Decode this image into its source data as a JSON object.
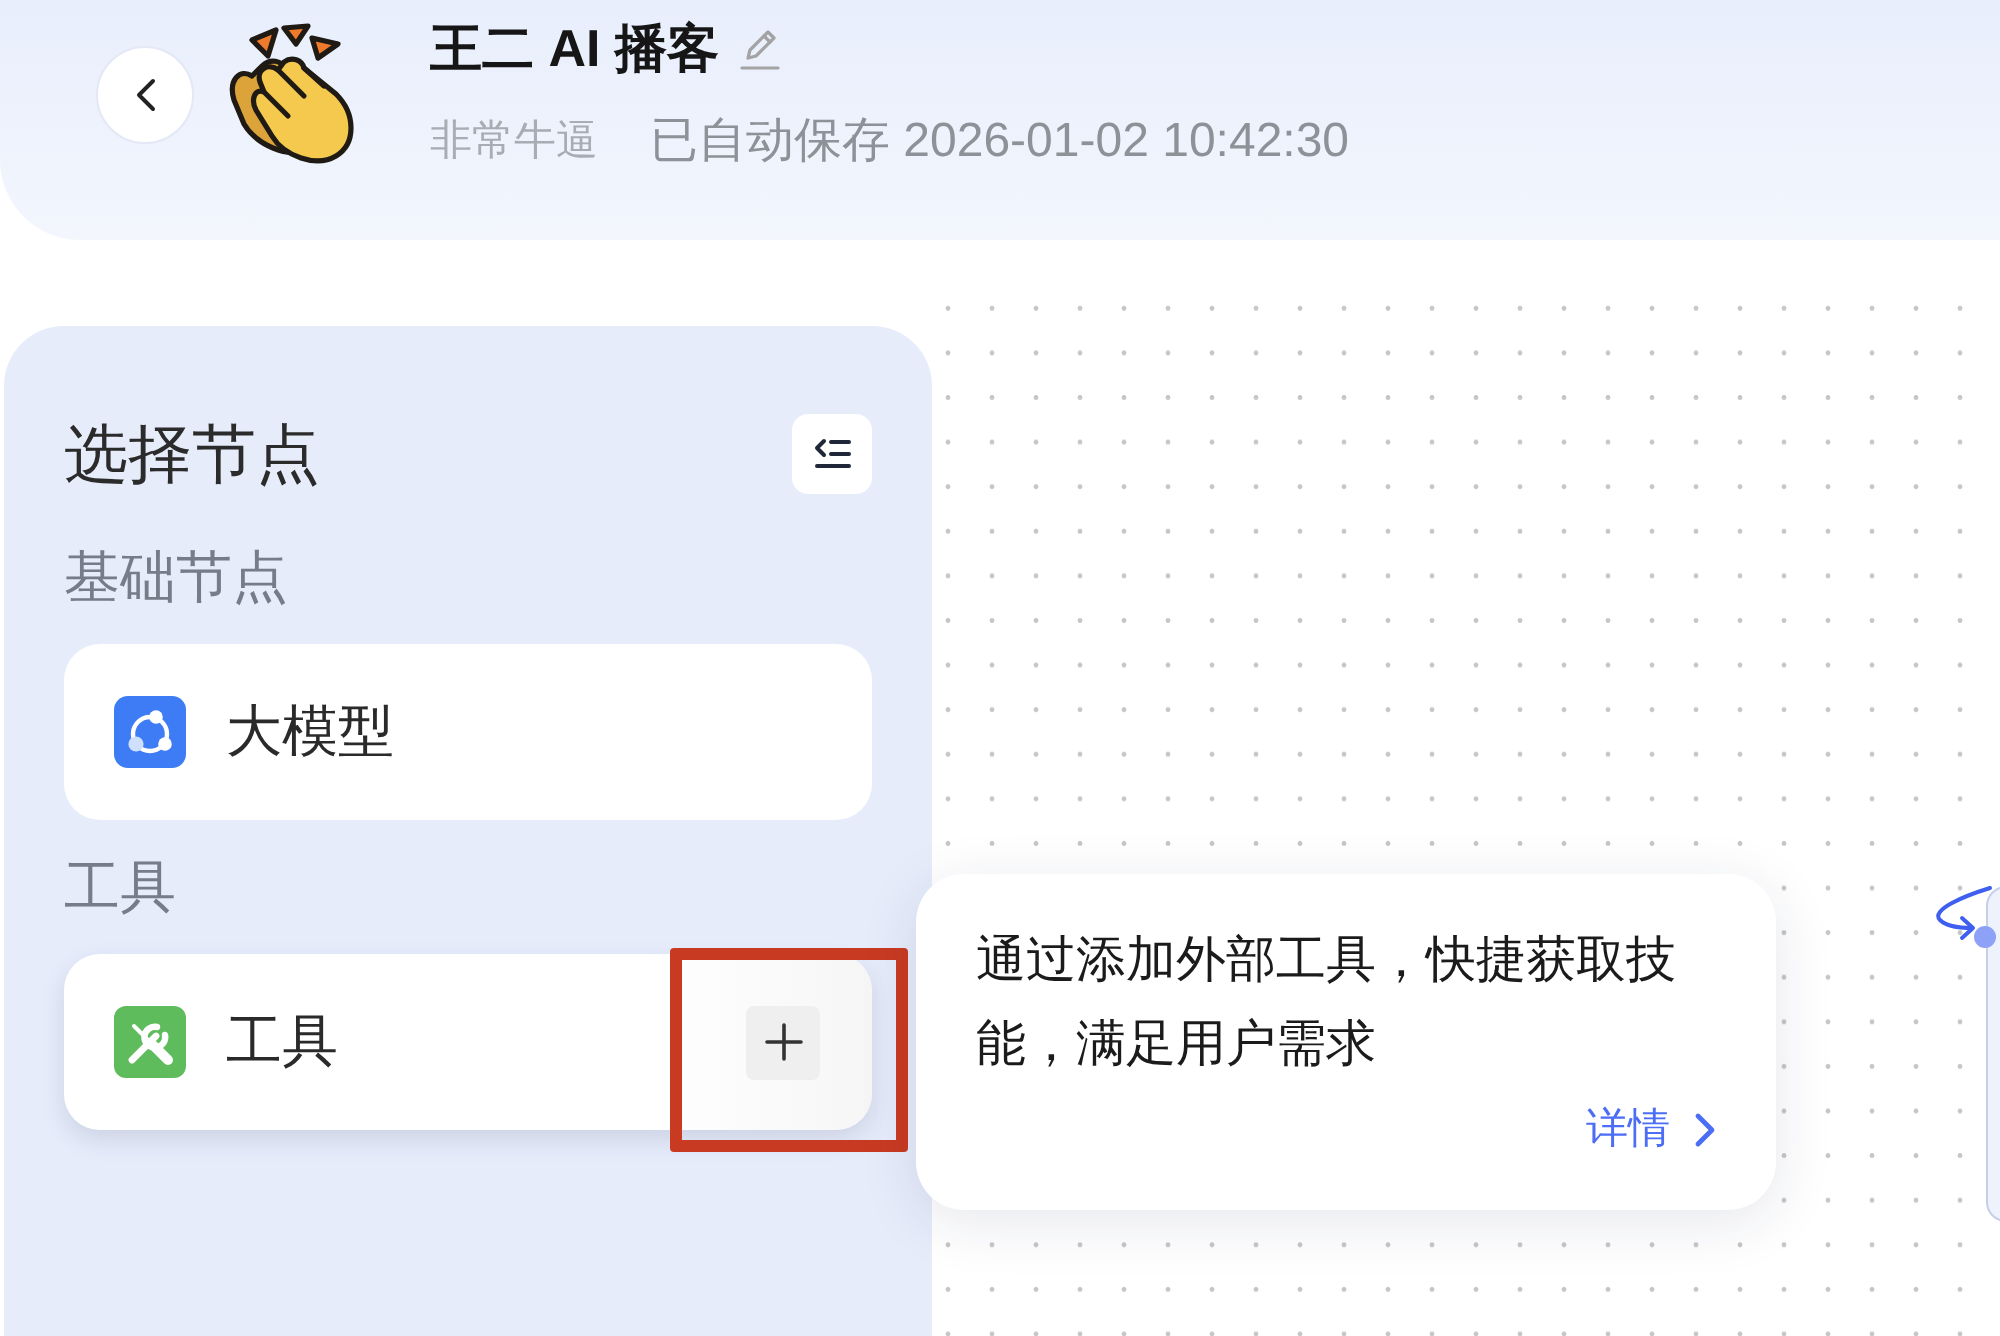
{
  "header": {
    "title": "王二 AI 播客",
    "description": "非常牛逼",
    "save_status": "已自动保存 2026-01-02 10:42:30"
  },
  "node_panel": {
    "title": "选择节点",
    "groups": [
      {
        "label": "基础节点",
        "items": [
          {
            "label": "大模型",
            "kind": "llm",
            "hovered": false,
            "highlighted": false
          }
        ]
      },
      {
        "label": "工具",
        "items": [
          {
            "label": "工具",
            "kind": "tool",
            "hovered": true,
            "highlighted": true
          }
        ]
      }
    ]
  },
  "tooltip": {
    "text": "通过添加外部工具，快捷获取技能，满足用户需求",
    "link": "详情"
  }
}
